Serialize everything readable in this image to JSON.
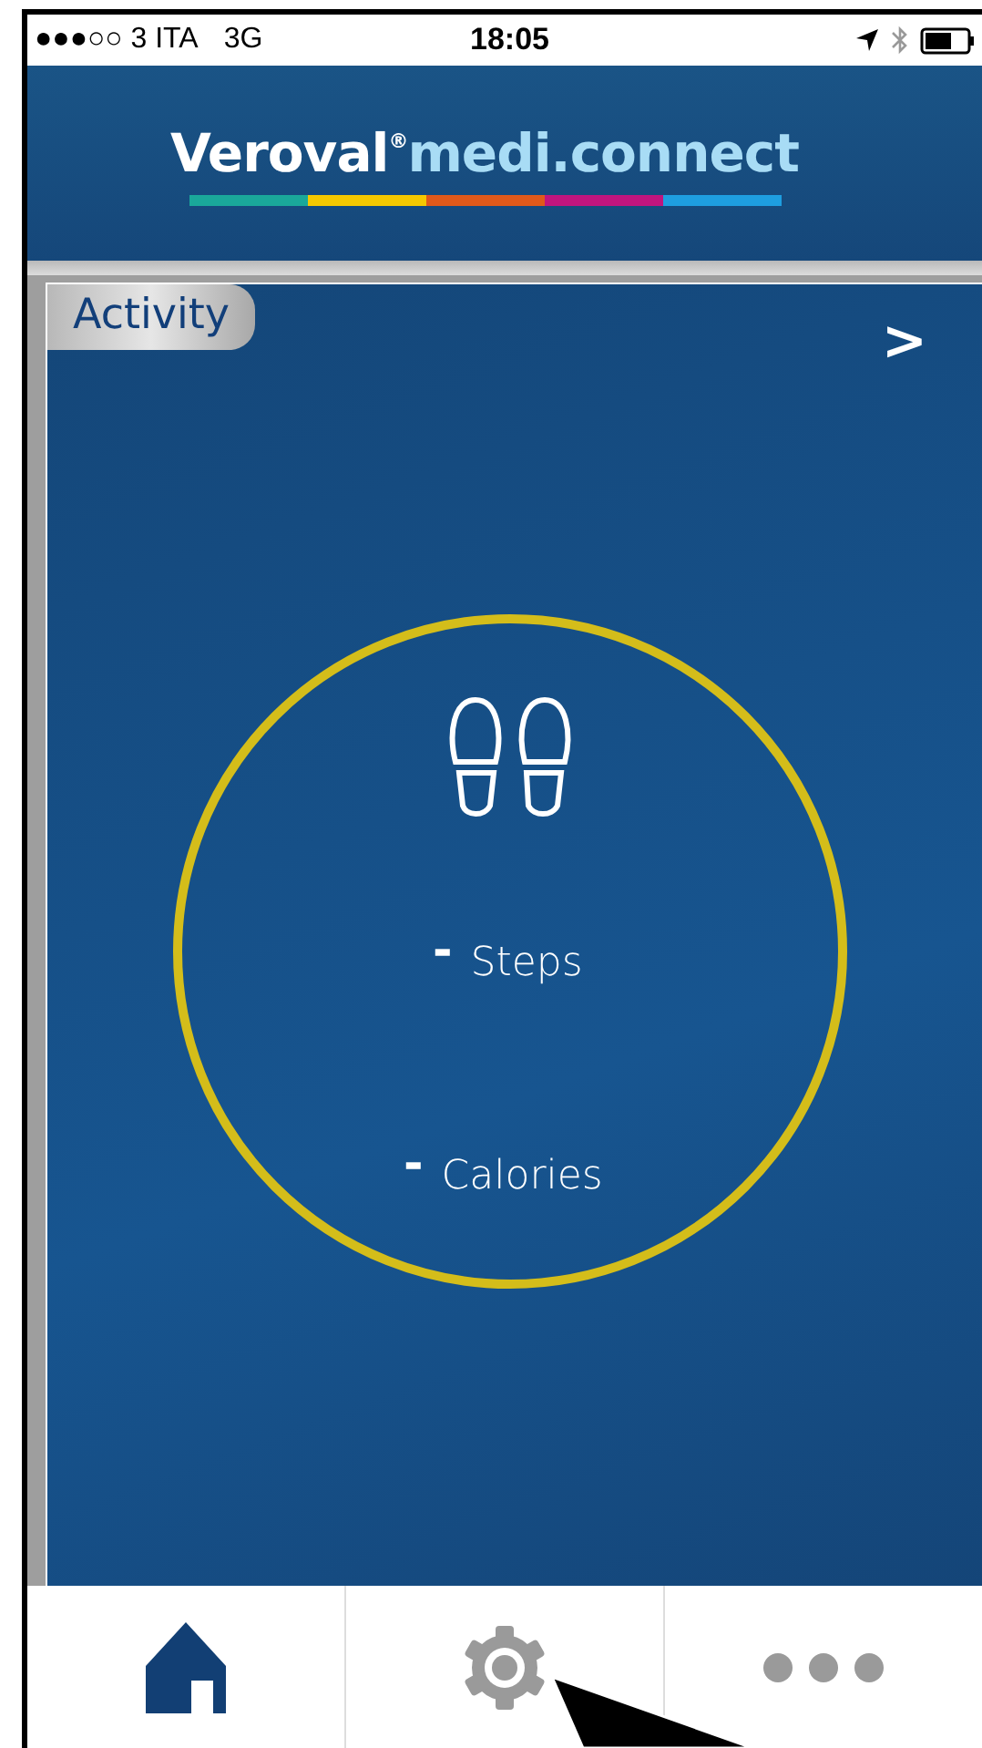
{
  "status_bar": {
    "carrier": "●●●○○ 3 ITA",
    "network": "3G",
    "time": "18:05"
  },
  "header": {
    "brand": "Veroval",
    "mark": "®",
    "product": "medi.connect"
  },
  "card": {
    "title": "Activity",
    "next": ">",
    "metrics": [
      {
        "value": "-",
        "label": "Steps"
      },
      {
        "value": "-",
        "label": "Calories"
      }
    ]
  },
  "tab_bar": [
    {
      "kind": "home",
      "selected": true
    },
    {
      "kind": "settings",
      "selected": false
    },
    {
      "kind": "more",
      "selected": false
    }
  ]
}
